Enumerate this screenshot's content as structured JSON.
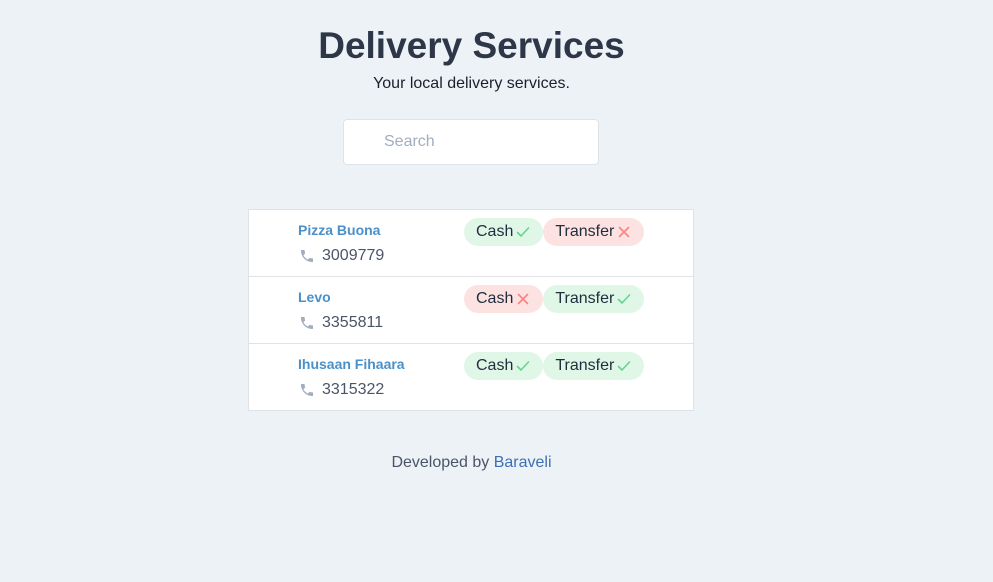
{
  "header": {
    "title": "Delivery Services",
    "subtitle": "Your local delivery services."
  },
  "search": {
    "placeholder": "Search",
    "value": ""
  },
  "services": [
    {
      "name": "Pizza Buona",
      "phone": "3009779",
      "payments": [
        {
          "label": "Cash",
          "accepted": true
        },
        {
          "label": "Transfer",
          "accepted": false
        }
      ]
    },
    {
      "name": "Levo",
      "phone": "3355811",
      "payments": [
        {
          "label": "Cash",
          "accepted": false
        },
        {
          "label": "Transfer",
          "accepted": true
        }
      ]
    },
    {
      "name": "Ihusaan Fihaara",
      "phone": "3315322",
      "payments": [
        {
          "label": "Cash",
          "accepted": true
        },
        {
          "label": "Transfer",
          "accepted": true
        }
      ]
    }
  ],
  "footer": {
    "prefix": "Developed by",
    "link_label": "Baraveli"
  },
  "colors": {
    "background": "#edf2f7",
    "accepted_badge": "#e0f7e7",
    "accepted_mark": "#68d391",
    "rejected_badge": "#fde2e2",
    "rejected_mark": "#fc8181",
    "service_name": "#4a90c9",
    "footer_link": "#3d6fb4",
    "phone_icon": "#a0aec0"
  },
  "icons": {
    "phone": "phone-icon",
    "accepted": "check-icon",
    "rejected": "x-icon"
  }
}
